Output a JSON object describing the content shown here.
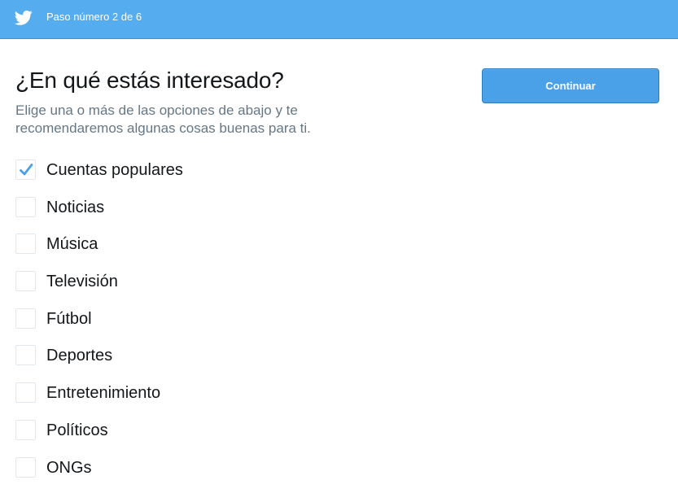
{
  "header": {
    "logo_icon": "twitter-bird-icon",
    "step_label": "Paso número 2 de 6",
    "background_color": "#55acee"
  },
  "main": {
    "title": "¿En qué estás interesado?",
    "subtitle": "Elige una o más de las opciones de abajo y te recomendaremos algunas cosas buenas para ti.",
    "continue_label": "Continuar",
    "accent_color": "#4aa1e8",
    "options": [
      {
        "label": "Cuentas populares",
        "checked": true
      },
      {
        "label": "Noticias",
        "checked": false
      },
      {
        "label": "Música",
        "checked": false
      },
      {
        "label": "Televisión",
        "checked": false
      },
      {
        "label": "Fútbol",
        "checked": false
      },
      {
        "label": "Deportes",
        "checked": false
      },
      {
        "label": "Entretenimiento",
        "checked": false
      },
      {
        "label": "Políticos",
        "checked": false
      },
      {
        "label": "ONGs",
        "checked": false
      }
    ]
  }
}
